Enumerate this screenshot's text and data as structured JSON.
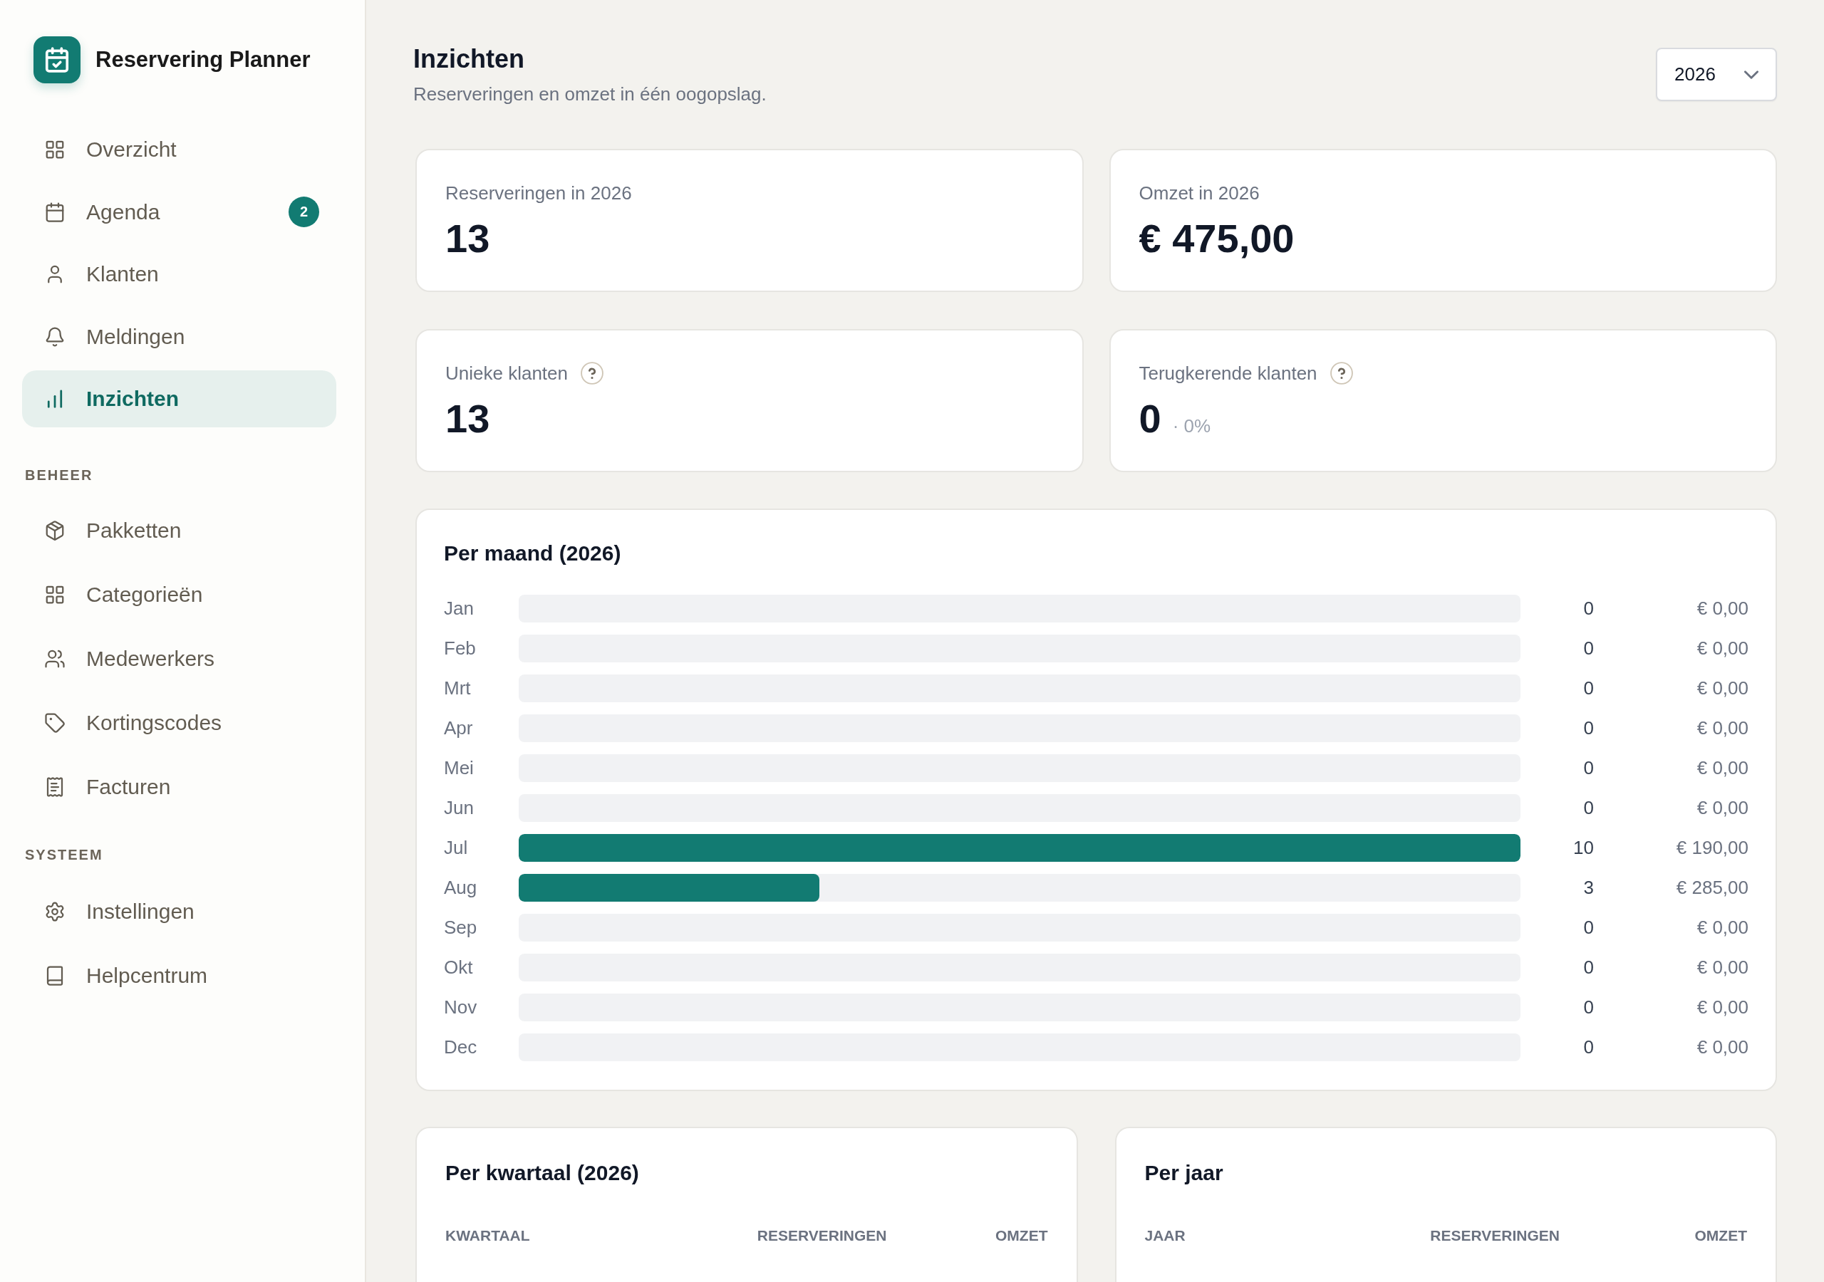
{
  "sidebar": {
    "app_name": "Reservering Planner",
    "groups": [
      {
        "items": [
          {
            "label": "Overzicht",
            "selected": false
          },
          {
            "label": "Agenda",
            "selected": false,
            "badge": "2"
          },
          {
            "label": "Klanten",
            "selected": false
          },
          {
            "label": "Meldingen",
            "selected": false
          },
          {
            "label": "Inzichten",
            "selected": true
          }
        ]
      },
      {
        "heading": "BEHEER",
        "items": [
          {
            "label": "Pakketten",
            "selected": false
          },
          {
            "label": "Categorieën",
            "selected": false
          },
          {
            "label": "Medewerkers",
            "selected": false
          },
          {
            "label": "Kortingscodes",
            "selected": false
          },
          {
            "label": "Facturen",
            "selected": false
          }
        ]
      },
      {
        "heading": "SYSTEEM",
        "items": [
          {
            "label": "Instellingen",
            "selected": false
          },
          {
            "label": "Helpcentrum",
            "selected": false
          }
        ]
      }
    ]
  },
  "header": {
    "title": "Inzichten",
    "subtitle": "Reserveringen en omzet in één oogopslag.",
    "year_select": {
      "value": "2026"
    }
  },
  "stats": [
    {
      "label": "Reserveringen in 2026",
      "value": "13",
      "help": false
    },
    {
      "label": "Omzet in 2026",
      "value": "€ 475,00",
      "help": false
    },
    {
      "label": "Unieke klanten",
      "value": "13",
      "help": true
    },
    {
      "label": "Terugkerende klanten",
      "value": "0",
      "help": true,
      "note": "· 0%"
    }
  ],
  "monthly": {
    "title": "Per maand (2026)",
    "rows": [
      {
        "month": "Jan",
        "count": "0",
        "amount": "€ 0,00"
      },
      {
        "month": "Feb",
        "count": "0",
        "amount": "€ 0,00"
      },
      {
        "month": "Mrt",
        "count": "0",
        "amount": "€ 0,00"
      },
      {
        "month": "Apr",
        "count": "0",
        "amount": "€ 0,00"
      },
      {
        "month": "Mei",
        "count": "0",
        "amount": "€ 0,00"
      },
      {
        "month": "Jun",
        "count": "0",
        "amount": "€ 0,00"
      },
      {
        "month": "Jul",
        "level": 1,
        "count": "10",
        "amount": "€ 190,00"
      },
      {
        "month": "Aug",
        "level": 0.3,
        "count": "3",
        "amount": "€ 285,00"
      },
      {
        "month": "Sep",
        "count": "0",
        "amount": "€ 0,00"
      },
      {
        "month": "Okt",
        "count": "0",
        "amount": "€ 0,00"
      },
      {
        "month": "Nov",
        "count": "0",
        "amount": "€ 0,00"
      },
      {
        "month": "Dec",
        "count": "0",
        "amount": "€ 0,00"
      }
    ]
  },
  "quarterly": {
    "title": "Per kwartaal (2026)",
    "columns": [
      "KWARTAAL",
      "RESERVERINGEN",
      "OMZET"
    ]
  },
  "yearly": {
    "title": "Per jaar",
    "columns": [
      "JAAR",
      "RESERVERINGEN",
      "OMZET"
    ]
  }
}
